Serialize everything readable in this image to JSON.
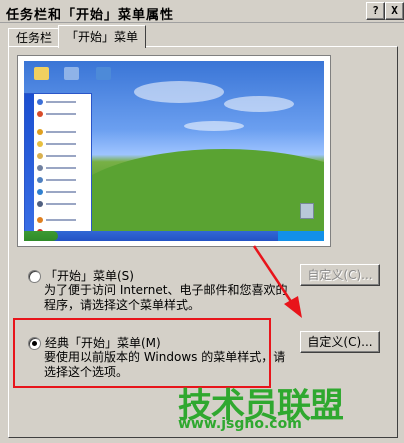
{
  "window": {
    "title": "任务栏和「开始」菜单属性",
    "help_button": "?",
    "close_button": "X"
  },
  "tabs": [
    {
      "label": "任务栏"
    },
    {
      "label": "「开始」菜单"
    }
  ],
  "options": {
    "start_menu": {
      "label": "「开始」菜单(S)",
      "description": "为了便于访问 Internet、电子邮件和您喜欢的程序，请选择这个菜单样式。",
      "customize_label": "自定义(C)...",
      "selected": false
    },
    "classic_start_menu": {
      "label": "经典「开始」菜单(M)",
      "description": "要使用以前版本的 Windows 的菜单样式，请选择这个选项。",
      "customize_label": "自定义(C)...",
      "selected": true
    }
  },
  "watermark": {
    "brand": "技术员联盟",
    "url": "www.jsgho.com"
  },
  "colors": {
    "highlight": "#e8141b",
    "accent": "#2fa82f"
  }
}
